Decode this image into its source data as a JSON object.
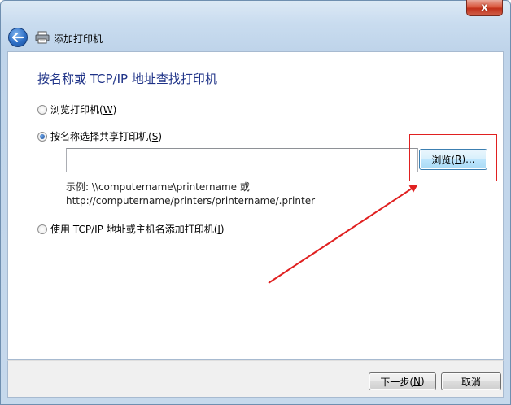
{
  "window": {
    "title": "添加打印机",
    "close_glyph": "x"
  },
  "heading": "按名称或 TCP/IP 地址查找打印机",
  "options": [
    {
      "label": "浏览打印机(",
      "key": "W",
      "suffix": ")",
      "checked": false
    },
    {
      "label": "按名称选择共享打印机(",
      "key": "S",
      "suffix": ")",
      "checked": true
    },
    {
      "label": "使用 TCP/IP 地址或主机名添加打印机(",
      "key": "I",
      "suffix": ")",
      "checked": false
    }
  ],
  "share_input": {
    "value": ""
  },
  "browse_button": {
    "label": "浏览(",
    "key": "R",
    "suffix": ")..."
  },
  "example": {
    "line1": "示例: \\\\computername\\printername 或",
    "line2": "http://computername/printers/printername/.printer"
  },
  "footer": {
    "next": {
      "label": "下一步(",
      "key": "N",
      "suffix": ")"
    },
    "cancel": {
      "label": "取消"
    }
  },
  "colors": {
    "heading": "#1e3287",
    "annotation": "#e02020"
  },
  "icons": [
    "back-arrow-icon",
    "printer-icon",
    "close-icon"
  ]
}
